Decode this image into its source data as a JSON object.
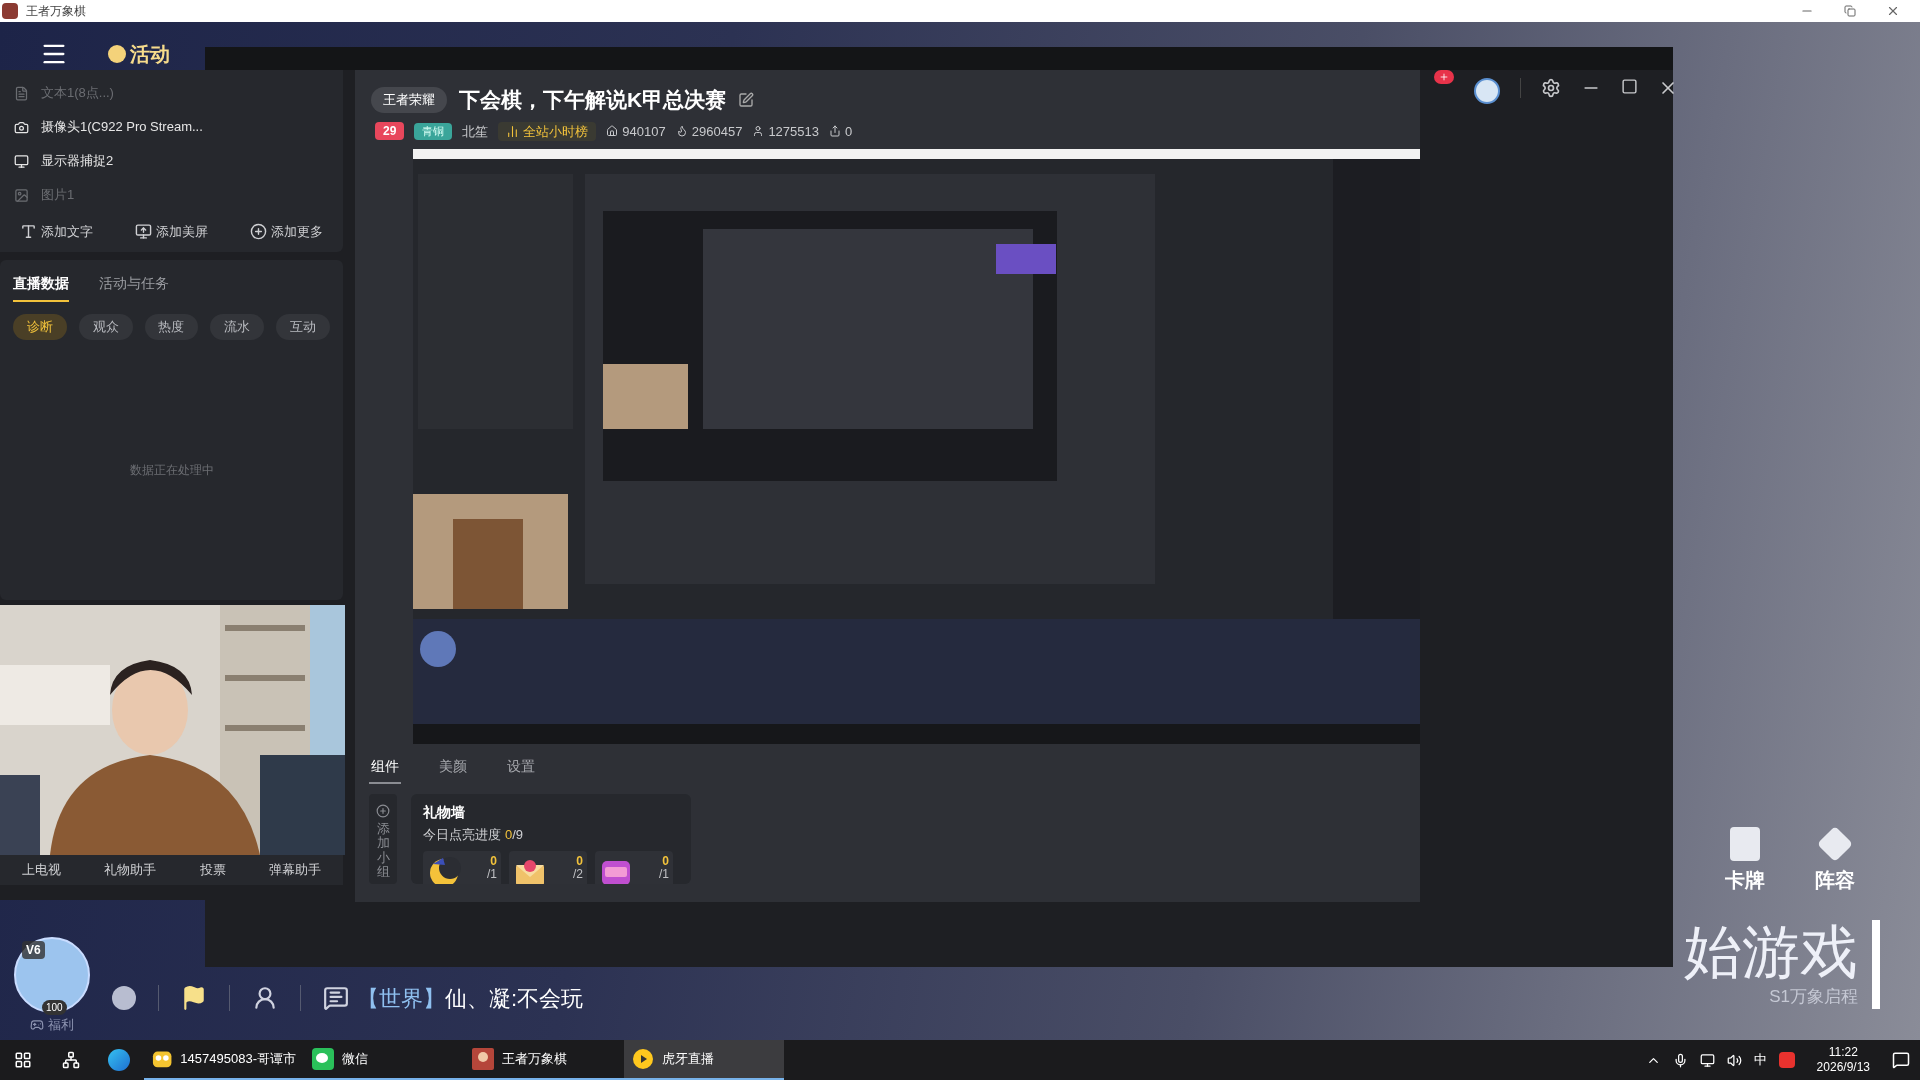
{
  "window": {
    "title": "王者万象棋"
  },
  "game_top_bar": {
    "label": "活动"
  },
  "sources": [
    {
      "label": "文本1(8点...)",
      "kind": "text",
      "visible": false
    },
    {
      "label": "摄像头1(C922 Pro Stream...",
      "kind": "camera",
      "visible": true
    },
    {
      "label": "显示器捕捉2",
      "kind": "monitor",
      "visible": true
    },
    {
      "label": "图片1",
      "visible": false
    }
  ],
  "add_actions": [
    {
      "label": "添加文字",
      "kind": "text"
    },
    {
      "label": "添加美屏",
      "kind": "screen"
    },
    {
      "label": "添加更多",
      "kind": "more"
    }
  ],
  "data_tabs": [
    {
      "label": "直播数据",
      "selected": true
    },
    {
      "label": "活动与任务",
      "selected": false
    }
  ],
  "data_chips": [
    {
      "label": "诊断",
      "selected": true
    },
    {
      "label": "观众",
      "selected": false
    },
    {
      "label": "热度",
      "selected": false
    },
    {
      "label": "流水",
      "selected": false
    },
    {
      "label": "互动",
      "selected": false
    }
  ],
  "data_status": "数据正在处理中",
  "camera_actions": [
    "上电视",
    "礼物助手",
    "投票",
    "弹幕助手"
  ],
  "stream": {
    "category": "王者荣耀",
    "title": "下会棋，下午解说K甲总决赛",
    "level": "29",
    "rank_badge": "青铜",
    "anchor": "北笙",
    "hourly_rank": "全站小时榜",
    "stats": [
      {
        "kind": "home",
        "value": "940107"
      },
      {
        "kind": "heat",
        "value": "2960457"
      },
      {
        "kind": "user",
        "value": "1275513"
      },
      {
        "kind": "share",
        "value": "0"
      }
    ]
  },
  "bottom_tabs": [
    {
      "label": "组件",
      "selected": true
    },
    {
      "label": "美颜",
      "selected": false
    },
    {
      "label": "设置",
      "selected": false
    }
  ],
  "add_widget": "添加小组",
  "gift_wall": {
    "title": "礼物墙",
    "progress_label": "今日点亮进度",
    "progress_done": "0",
    "progress_total": "/9",
    "gifts": [
      {
        "kind": "moon",
        "count": "0",
        "target": "/1"
      },
      {
        "kind": "envelope",
        "count": "0",
        "target": "/2"
      },
      {
        "kind": "card",
        "count": "0",
        "target": "/1"
      }
    ]
  },
  "game_bottom": {
    "vip": "V6",
    "avatar_level": "100",
    "welfare": "福利",
    "chat_channel": "【世界】",
    "chat_message": "仙、凝:不会玩"
  },
  "game_side": [
    {
      "label": "卡牌",
      "kind": "cards"
    },
    {
      "label": "阵容",
      "kind": "lineup"
    }
  ],
  "game_banner": {
    "title": "始游戏",
    "subtitle": "S1万象启程"
  },
  "taskbar": {
    "apps": [
      {
        "label": "1457495083-哥谭市",
        "kind": "owl",
        "selected": false
      },
      {
        "label": "微信",
        "kind": "chat",
        "selected": false
      },
      {
        "label": "王者万象棋",
        "kind": "game",
        "selected": false
      },
      {
        "label": "虎牙直播",
        "kind": "huya",
        "selected": true
      }
    ],
    "ime": "中",
    "time": "11:22",
    "date": "2026/9/13"
  }
}
